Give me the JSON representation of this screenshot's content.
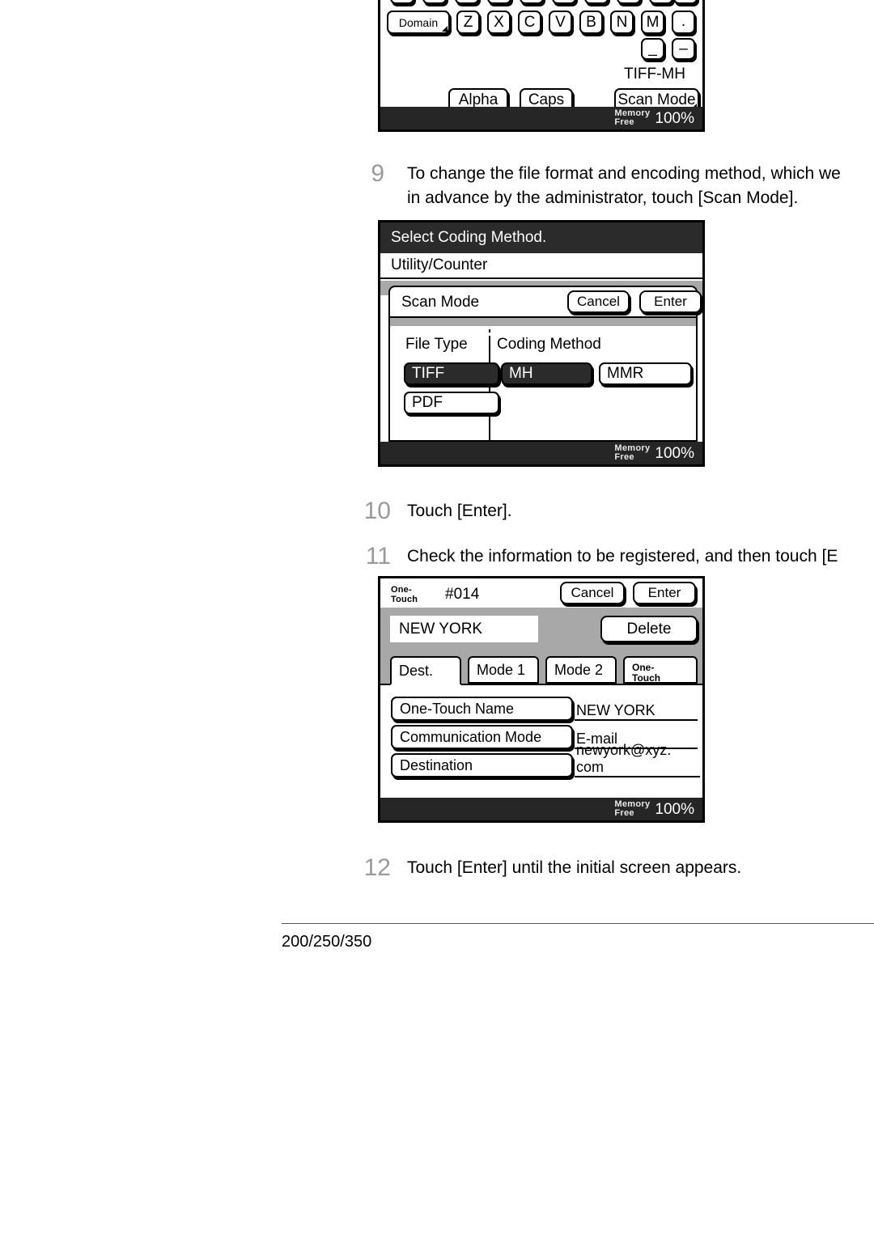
{
  "document": {
    "footer_model": "200/250/350"
  },
  "steps": [
    {
      "number": "9",
      "text": "To change the file format and encoding method, which we\nin advance by the administrator, touch [Scan Mode]."
    },
    {
      "number": "10",
      "text": "Touch [Enter]."
    },
    {
      "number": "11",
      "text": "Check the information to be registered, and then touch [E"
    },
    {
      "number": "12",
      "text": "Touch [Enter] until the initial screen appears."
    }
  ],
  "panel_keyboard": {
    "name": "keyboard-panel",
    "row_top_keys": [
      "",
      "",
      "",
      "",
      "",
      "",
      "",
      "",
      ""
    ],
    "row_letters": [
      {
        "label": "Domain",
        "popup": true,
        "wide": true
      },
      {
        "label": "Z",
        "popup": false,
        "wide": false
      },
      {
        "label": "X",
        "popup": false,
        "wide": false
      },
      {
        "label": "C",
        "popup": false,
        "wide": false
      },
      {
        "label": "V",
        "popup": false,
        "wide": false
      },
      {
        "label": "B",
        "popup": false,
        "wide": false
      },
      {
        "label": "N",
        "popup": false,
        "wide": false
      },
      {
        "label": "M",
        "popup": false,
        "wide": false
      },
      {
        "label": ".",
        "popup": false,
        "wide": false
      },
      {
        "label": ",",
        "popup": false,
        "wide": false
      }
    ],
    "row_symbols": [
      {
        "label": "_",
        "name": "underscore-key"
      },
      {
        "label": "–",
        "name": "hyphen-key"
      }
    ],
    "alpha_label": "Alpha",
    "caps_label": "Caps",
    "scan_mode_value": "TIFF-MH",
    "scan_mode_label": "Scan Mode",
    "memory_label_line1": "Memory",
    "memory_label_line2": "Free",
    "memory_value": "100%"
  },
  "panel_scanmode": {
    "title": "Select Coding Method.",
    "subtitle": "Utility/Counter",
    "dialog_title": "Scan Mode",
    "cancel_label": "Cancel",
    "enter_label": "Enter",
    "file_type_label": "File Type",
    "coding_method_label": "Coding Method",
    "file_types": [
      {
        "label": "TIFF",
        "selected": true
      },
      {
        "label": "PDF",
        "selected": false
      }
    ],
    "coding_methods": [
      {
        "label": "MH",
        "selected": true
      },
      {
        "label": "MMR",
        "selected": false
      }
    ],
    "memory_label_line1": "Memory",
    "memory_label_line2": "Free",
    "memory_value": "100%"
  },
  "panel_onetouch": {
    "header_label_line1": "One-",
    "header_label_line2": "Touch",
    "entry_number": "#014",
    "cancel_label": "Cancel",
    "enter_label": "Enter",
    "delete_label": "Delete",
    "name_value": "NEW YORK",
    "tabs": [
      {
        "label": "Dest.",
        "active": true,
        "stacked": false
      },
      {
        "label": "Mode 1",
        "active": false,
        "stacked": false
      },
      {
        "label": "Mode 2",
        "active": false,
        "stacked": false
      },
      {
        "label_line1": "One-",
        "label_line2": "Touch",
        "active": false,
        "stacked": true
      }
    ],
    "fields": [
      {
        "label": "One-Touch Name",
        "value": "NEW YORK"
      },
      {
        "label": "Communication Mode",
        "value": "E-mail"
      },
      {
        "label": "Destination",
        "value": "newyork@xyz. com"
      }
    ],
    "memory_label_line1": "Memory",
    "memory_label_line2": "Free",
    "memory_value": "100%"
  }
}
